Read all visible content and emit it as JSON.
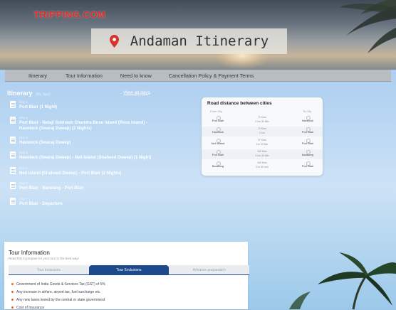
{
  "brand": {
    "logo": "TRIPPING.COM"
  },
  "hero": {
    "title": "Andaman Itinerary"
  },
  "nav": [
    "Itinerary",
    "Tour Information",
    "Need to know",
    "Cancellation Policy & Payment Terms"
  ],
  "itinerary": {
    "heading": "Itinerary",
    "sub": "(by day)",
    "view_all": "View all days",
    "days": [
      {
        "label": "Day 1",
        "title": "Port Blair (1 Night)"
      },
      {
        "label": "Day 2",
        "title": "Port Blair - Netaji Subhash Chandra Bose Island (Ross Island) -\nHavelock (Swaraj Dweep) (2 Nights)"
      },
      {
        "label": "Day 3",
        "title": "Havelock (Swaraj Dweep)"
      },
      {
        "label": "Day 4",
        "title": "Havelock (Swaraj Dweep) - Neil Island (Shaheed Dweep) (1 Night)"
      },
      {
        "label": "Day 5",
        "title": "Neil Island (Shaheed Dweep) - Port Blair (2 Nights)"
      },
      {
        "label": "Day 6",
        "title": "Port Blair - Baratang - Port Blair"
      },
      {
        "label": "Day 7",
        "title": "Port Blair - Departure"
      }
    ]
  },
  "road": {
    "title": "Road distance between cities",
    "from_label": "From City",
    "to_label": "To City",
    "rows": [
      {
        "from": "Port Blair",
        "to": "Havelock",
        "km": "72 Kms",
        "time": "2 hrs 30 Min"
      },
      {
        "from": "Havelock",
        "to": "Port Blair",
        "km": "72 Kms",
        "time": "2 hrs"
      },
      {
        "from": "Neil Island",
        "to": "Port Blair",
        "km": "37 Kms",
        "time": "1hr 30 Min"
      },
      {
        "from": "Port Blair",
        "to": "Baratang",
        "km": "100 Kms",
        "time": "3 hrs 30 Min"
      },
      {
        "from": "Baratang",
        "to": "Port Blair",
        "km": "100 Kms",
        "time": "3 hr 30 min"
      }
    ]
  },
  "tour": {
    "title": "Tour Information",
    "sub": "Read this to prepare for your tour in the best way!",
    "tabs": [
      "Tour Inclusions",
      "Tour Exclusions",
      "Advance preparation"
    ],
    "exclusions": [
      "Government of India Goods & Services Tax (GST) of 5%",
      "Any increase in airfare, airport tax, fuel surcharge etc.",
      "Any new taxes levied by the central or state government",
      "Cost of Insurance"
    ]
  }
}
